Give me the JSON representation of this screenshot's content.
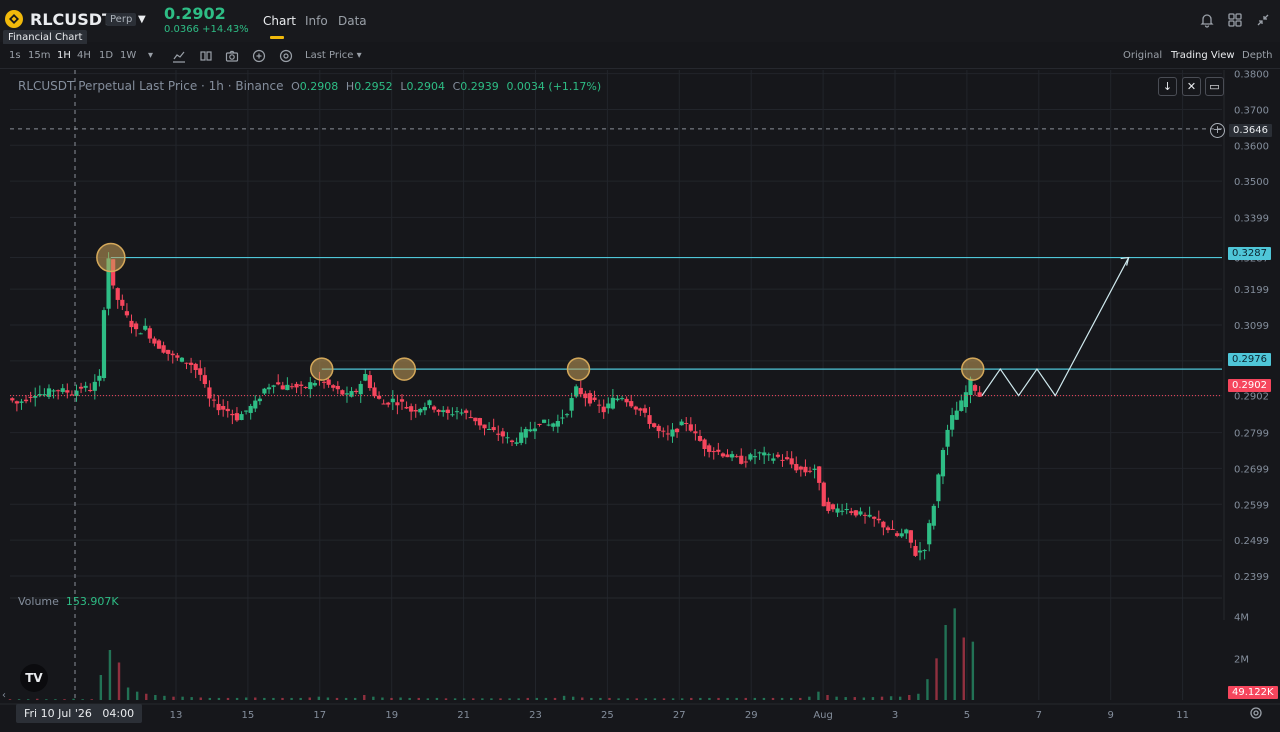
{
  "header": {
    "symbol": "RLCUSDT",
    "badge": "Perp",
    "tooltip": "Financial Chart",
    "last_price": "0.2902",
    "change": "0.0366 +14.43%",
    "tabs": [
      "Chart",
      "Info",
      "Data"
    ]
  },
  "toolbar": {
    "timeframes": [
      "1s",
      "15m",
      "1H",
      "4H",
      "1D",
      "1W"
    ],
    "active_timeframe": "1H",
    "price_type": "Last Price",
    "views": [
      "Original",
      "Trading View",
      "Depth"
    ],
    "active_view": "Trading View"
  },
  "legend": {
    "title": "RLCUSDT Perpetual Last Price · 1h · Binance",
    "o_label": "O",
    "o": "0.2908",
    "h_label": "H",
    "h": "0.2952",
    "l_label": "L",
    "l": "0.2904",
    "c_label": "C",
    "c": "0.2939",
    "delta": "0.0034 (+1.17%)"
  },
  "volume_legend": {
    "label": "Volume",
    "value": "153.907K"
  },
  "crosshair": {
    "date": "Fri 10 Jul '26",
    "time": "04:00",
    "price": "0.3646"
  },
  "price_labels": {
    "level_high": "0.3287",
    "level_mid": "0.2976",
    "current": "0.2902",
    "volume_now": "49.122K"
  },
  "tv_logo": "TV",
  "colors": {
    "up": "#2ebd85",
    "down": "#f6465d",
    "accent": "#f0b90b",
    "line": "#4fc6d8"
  },
  "chart_data": {
    "type": "candlestick",
    "title": "RLCUSDT Perpetual Last Price · 1h · Binance",
    "y_ticks": [
      "0.3800",
      "0.3700",
      "0.3600",
      "0.3500",
      "0.3399",
      "0.3287",
      "0.3199",
      "0.3099",
      "0.2999",
      "0.2902",
      "0.2799",
      "0.2699",
      "0.2599",
      "0.2499",
      "0.2399"
    ],
    "x_ticks": [
      "13",
      "15",
      "17",
      "19",
      "21",
      "23",
      "25",
      "27",
      "29",
      "Aug",
      "3",
      "5",
      "7",
      "9",
      "11"
    ],
    "volume_ticks": [
      "4M",
      "2M"
    ],
    "ylim": [
      0.236,
      0.381
    ],
    "horizontal_levels": [
      0.3287,
      0.2976
    ],
    "current_price": 0.2902,
    "crosshair_price": 0.3646,
    "price_path": [
      [
        0,
        0.2895
      ],
      [
        1,
        0.288
      ],
      [
        2,
        0.2895
      ],
      [
        3,
        0.291
      ],
      [
        4,
        0.2905
      ],
      [
        5,
        0.292
      ],
      [
        6,
        0.2915
      ],
      [
        7,
        0.291
      ],
      [
        8,
        0.2925
      ],
      [
        9,
        0.292
      ],
      [
        10,
        0.295
      ],
      [
        10.5,
        0.315
      ],
      [
        11,
        0.3287
      ],
      [
        11.5,
        0.32
      ],
      [
        12,
        0.317
      ],
      [
        13,
        0.312
      ],
      [
        14,
        0.308
      ],
      [
        15,
        0.309
      ],
      [
        16,
        0.305
      ],
      [
        17,
        0.303
      ],
      [
        18,
        0.301
      ],
      [
        19,
        0.3
      ],
      [
        20,
        0.299
      ],
      [
        21,
        0.296
      ],
      [
        22,
        0.289
      ],
      [
        23,
        0.287
      ],
      [
        24,
        0.286
      ],
      [
        25,
        0.284
      ],
      [
        26,
        0.286
      ],
      [
        27,
        0.288
      ],
      [
        28,
        0.292
      ],
      [
        29,
        0.294
      ],
      [
        30,
        0.2925
      ],
      [
        31,
        0.293
      ],
      [
        32,
        0.292
      ],
      [
        33,
        0.2935
      ],
      [
        34,
        0.2945
      ],
      [
        35,
        0.293
      ],
      [
        36,
        0.2915
      ],
      [
        37,
        0.29
      ],
      [
        38,
        0.2915
      ],
      [
        39,
        0.296
      ],
      [
        40,
        0.29
      ],
      [
        41,
        0.288
      ],
      [
        42,
        0.289
      ],
      [
        43,
        0.288
      ],
      [
        44,
        0.286
      ],
      [
        45,
        0.287
      ],
      [
        46,
        0.288
      ],
      [
        47,
        0.286
      ],
      [
        48,
        0.285
      ],
      [
        49,
        0.286
      ],
      [
        50,
        0.285
      ],
      [
        51,
        0.2835
      ],
      [
        52,
        0.281
      ],
      [
        53,
        0.28
      ],
      [
        54,
        0.279
      ],
      [
        55,
        0.277
      ],
      [
        56,
        0.279
      ],
      [
        57,
        0.281
      ],
      [
        58,
        0.283
      ],
      [
        59,
        0.282
      ],
      [
        60,
        0.283
      ],
      [
        61,
        0.286
      ],
      [
        62,
        0.292
      ],
      [
        63,
        0.29
      ],
      [
        64,
        0.288
      ],
      [
        65,
        0.286
      ],
      [
        66,
        0.289
      ],
      [
        67,
        0.29
      ],
      [
        68,
        0.288
      ],
      [
        69,
        0.286
      ],
      [
        70,
        0.283
      ],
      [
        71,
        0.28
      ],
      [
        72,
        0.279
      ],
      [
        73,
        0.281
      ],
      [
        74,
        0.283
      ],
      [
        75,
        0.279
      ],
      [
        76,
        0.276
      ],
      [
        77,
        0.275
      ],
      [
        78,
        0.274
      ],
      [
        79,
        0.273
      ],
      [
        80,
        0.272
      ],
      [
        81,
        0.273
      ],
      [
        82,
        0.274
      ],
      [
        83,
        0.273
      ],
      [
        84,
        0.273
      ],
      [
        85,
        0.272
      ],
      [
        86,
        0.27
      ],
      [
        87,
        0.269
      ],
      [
        88,
        0.27
      ],
      [
        89,
        0.26
      ],
      [
        90,
        0.258
      ],
      [
        91,
        0.259
      ],
      [
        92,
        0.258
      ],
      [
        93,
        0.257
      ],
      [
        94,
        0.256
      ],
      [
        95,
        0.255
      ],
      [
        96,
        0.253
      ],
      [
        97,
        0.251
      ],
      [
        98,
        0.252
      ],
      [
        99,
        0.246
      ],
      [
        100,
        0.248
      ],
      [
        101,
        0.26
      ],
      [
        102,
        0.276
      ],
      [
        103,
        0.284
      ],
      [
        104,
        0.288
      ],
      [
        105,
        0.294
      ],
      [
        106,
        0.2902
      ]
    ],
    "projection_path": [
      [
        106,
        0.2902
      ],
      [
        108,
        0.2976
      ],
      [
        110,
        0.2902
      ],
      [
        112,
        0.2976
      ],
      [
        114,
        0.2902
      ],
      [
        122,
        0.3287
      ]
    ],
    "marked_touches": [
      [
        11,
        0.3287
      ],
      [
        34,
        0.2976
      ],
      [
        43,
        0.2976
      ],
      [
        62,
        0.2976
      ],
      [
        105,
        0.2976
      ]
    ],
    "volume": [
      0.02,
      0.02,
      0.02,
      0.03,
      0.02,
      0.02,
      0.02,
      0.03,
      0.02,
      0.02,
      0.6,
      1.2,
      0.9,
      0.3,
      0.2,
      0.15,
      0.12,
      0.1,
      0.08,
      0.08,
      0.07,
      0.06,
      0.05,
      0.05,
      0.05,
      0.05,
      0.06,
      0.06,
      0.05,
      0.05,
      0.05,
      0.05,
      0.05,
      0.06,
      0.08,
      0.06,
      0.05,
      0.05,
      0.05,
      0.12,
      0.08,
      0.06,
      0.05,
      0.06,
      0.05,
      0.05,
      0.04,
      0.05,
      0.04,
      0.04,
      0.04,
      0.04,
      0.04,
      0.04,
      0.04,
      0.04,
      0.04,
      0.05,
      0.05,
      0.05,
      0.05,
      0.1,
      0.08,
      0.06,
      0.05,
      0.05,
      0.05,
      0.04,
      0.04,
      0.04,
      0.04,
      0.04,
      0.04,
      0.04,
      0.04,
      0.05,
      0.05,
      0.05,
      0.05,
      0.05,
      0.05,
      0.05,
      0.05,
      0.05,
      0.05,
      0.05,
      0.05,
      0.05,
      0.08,
      0.2,
      0.12,
      0.08,
      0.07,
      0.07,
      0.06,
      0.07,
      0.08,
      0.09,
      0.08,
      0.12,
      0.15,
      0.5,
      1.0,
      1.8,
      2.2,
      1.5,
      1.4
    ]
  }
}
